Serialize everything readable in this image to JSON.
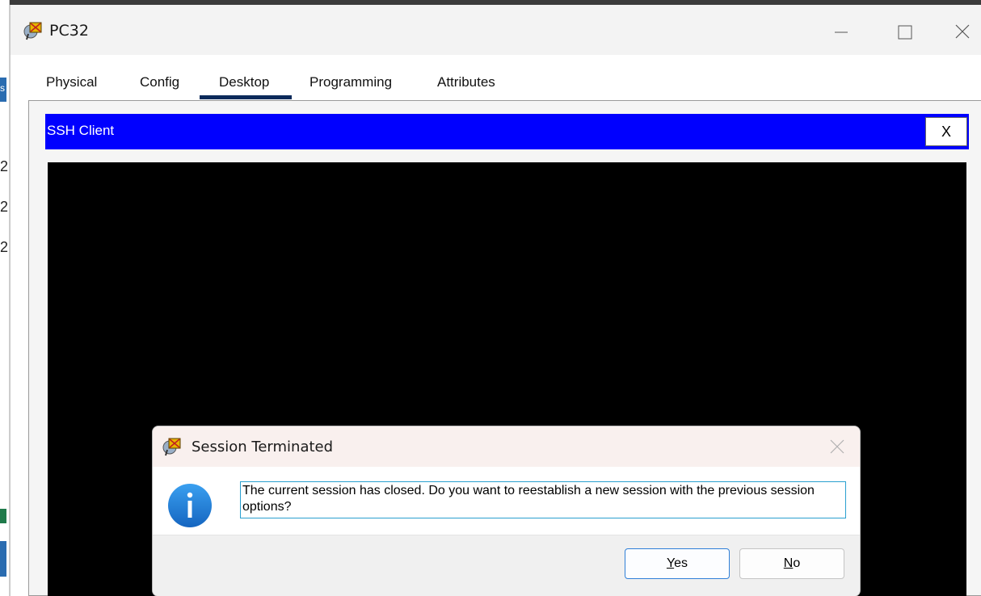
{
  "window": {
    "title": "PC32"
  },
  "tabs": [
    {
      "label": "Physical"
    },
    {
      "label": "Config"
    },
    {
      "label": "Desktop",
      "active": true
    },
    {
      "label": "Programming"
    },
    {
      "label": "Attributes"
    }
  ],
  "ssh": {
    "title": "SSH Client",
    "close_label": "X"
  },
  "background_marks": [
    "s",
    "2",
    "2",
    "2"
  ],
  "dialog": {
    "title": "Session Terminated",
    "message": "The current session has closed. Do you want to reestablish a new session with the previous session options?",
    "yes_accel": "Y",
    "yes_rest": "es",
    "no_accel": "N",
    "no_rest": "o"
  },
  "colors": {
    "ssh_header": "#0000ff",
    "terminal": "#000000",
    "active_tab_underline": "#0b2a5a",
    "info_icon": "#1e88e5"
  },
  "icons": [
    "packet-tracer-pc-icon",
    "minimize-icon",
    "maximize-icon",
    "close-icon",
    "info-icon"
  ]
}
